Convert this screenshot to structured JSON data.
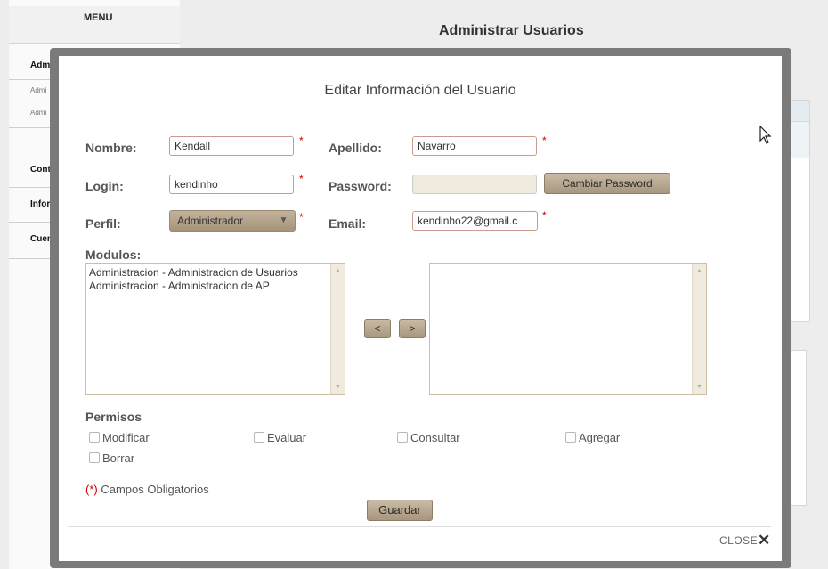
{
  "background": {
    "menu_title": "MENU",
    "page_title": "Administrar Usuarios",
    "sidebar_items": [
      {
        "label": "Admi",
        "type": "main"
      },
      {
        "label": "Admi",
        "type": "sub"
      },
      {
        "label": "Admi",
        "type": "sub"
      },
      {
        "label": "Conta",
        "type": "main"
      },
      {
        "label": "Inforn",
        "type": "main"
      },
      {
        "label": "Cuen",
        "type": "main"
      }
    ]
  },
  "modal": {
    "title": "Editar Información del Usuario",
    "required_marker": "*",
    "fields": {
      "nombre": {
        "label": "Nombre:",
        "value": "Kendall"
      },
      "apellido": {
        "label": "Apellido:",
        "value": "Navarro"
      },
      "login": {
        "label": "Login:",
        "value": "kendinho"
      },
      "password": {
        "label": "Password:",
        "value": ""
      },
      "perfil": {
        "label": "Perfil:",
        "value": "Administrador"
      },
      "email": {
        "label": "Email:",
        "value": "kendinho22@gmail.c"
      }
    },
    "cambiar_password_label": "Cambiar Password",
    "modulos": {
      "label": "Modulos:",
      "available": [
        "Administracion - Administracion de Usuarios",
        "Administracion - Administracion de AP"
      ],
      "selected": [],
      "move_left_label": "<",
      "move_right_label": ">"
    },
    "permisos": {
      "label": "Permisos",
      "options": [
        {
          "label": "Modificar",
          "checked": false
        },
        {
          "label": "Evaluar",
          "checked": false
        },
        {
          "label": "Consultar",
          "checked": false
        },
        {
          "label": "Agregar",
          "checked": false
        },
        {
          "label": "Borrar",
          "checked": false
        }
      ]
    },
    "required_note": {
      "marker": "(*)",
      "text": " Campos Obligatorios"
    },
    "save_label": "Guardar",
    "close_label": "CLOSE",
    "close_icon": "✕"
  },
  "colors": {
    "required": "#cc0000",
    "button": "#b3a28a",
    "overlay_frame": "#7a7a7a"
  }
}
